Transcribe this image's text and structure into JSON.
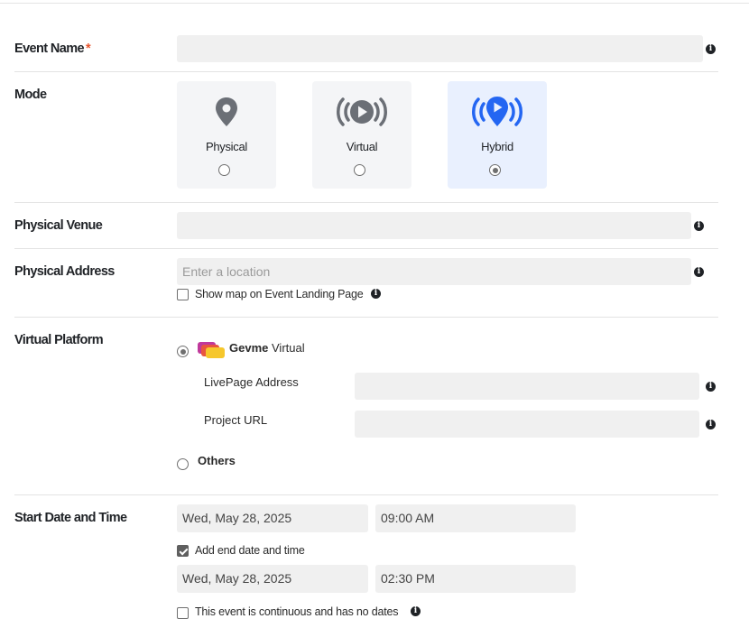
{
  "form": {
    "event_name": {
      "label": "Event Name",
      "required_mark": "*",
      "value": ""
    },
    "mode": {
      "label": "Mode",
      "options": [
        {
          "label": "Physical",
          "icon": "location-pin-icon",
          "selected": false
        },
        {
          "label": "Virtual",
          "icon": "broadcast-play-icon",
          "selected": false
        },
        {
          "label": "Hybrid",
          "icon": "broadcast-pin-icon",
          "selected": true
        }
      ]
    },
    "physical_venue": {
      "label": "Physical Venue",
      "value": ""
    },
    "physical_address": {
      "label": "Physical Address",
      "placeholder": "Enter a location",
      "show_map_label": "Show map on Event Landing Page",
      "show_map_checked": false
    },
    "virtual_platform": {
      "label": "Virtual Platform",
      "gevme": {
        "brand": "Gevme",
        "suffix": "Virtual",
        "selected": true
      },
      "livepage_label": "LivePage Address",
      "livepage_value": "",
      "project_url_label": "Project URL",
      "project_url_value": "",
      "others_label": "Others",
      "others_selected": false
    },
    "start_date": {
      "label": "Start Date and Time",
      "date": "Wed, May 28, 2025",
      "time": "09:00 AM",
      "add_end_label": "Add end date and time",
      "add_end_checked": true,
      "end_date": "Wed, May 28, 2025",
      "end_time": "02:30 PM",
      "continuous_label": "This event is continuous and has no dates",
      "continuous_checked": false
    }
  },
  "colors": {
    "accent_blue": "#2466f2",
    "icon_gray": "#6b6f76",
    "required_red": "#e8552e",
    "hybrid_card_bg": "#e9f0fe"
  },
  "info_glyph": "i"
}
